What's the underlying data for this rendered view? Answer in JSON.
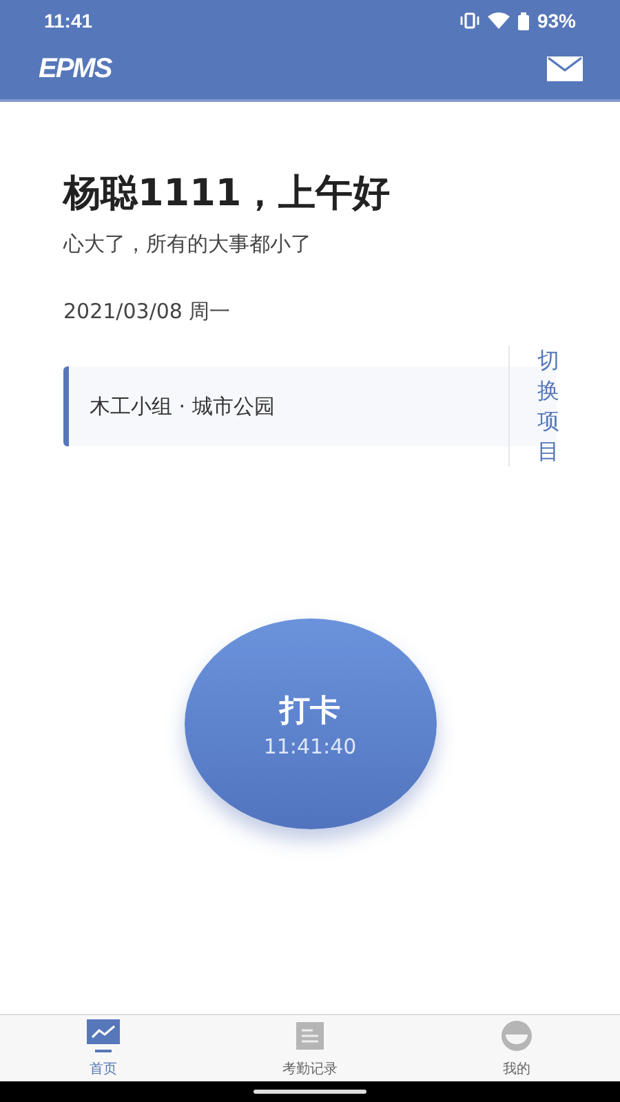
{
  "status_bar": {
    "time": "11:41",
    "battery": "93%"
  },
  "app_bar": {
    "logo": "EPMS"
  },
  "greeting": {
    "title": "杨聪1111，上午好",
    "motto": "心大了，所有的大事都小了",
    "date": "2021/03/08  周一"
  },
  "project": {
    "name": "木工小组 · 城市公园",
    "switch": "切换项目"
  },
  "punch": {
    "label": "打卡",
    "time": "11:41:40"
  },
  "tabs": [
    {
      "label": "首页",
      "kind": "chart",
      "selected": true
    },
    {
      "label": "考勤记录",
      "kind": "list",
      "selected": false
    },
    {
      "label": "我的",
      "kind": "face",
      "selected": false
    }
  ]
}
